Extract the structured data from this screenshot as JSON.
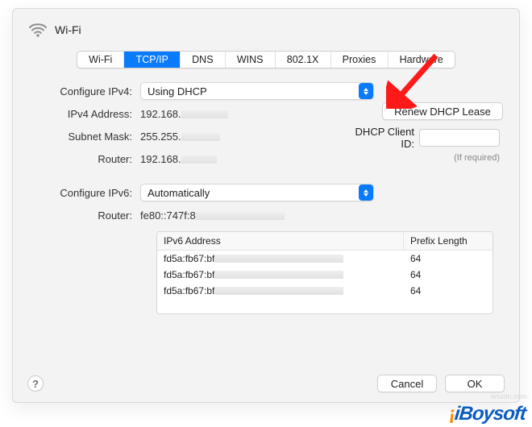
{
  "header": {
    "title": "Wi-Fi"
  },
  "tabs": [
    {
      "label": "Wi-Fi",
      "active": false
    },
    {
      "label": "TCP/IP",
      "active": true
    },
    {
      "label": "DNS",
      "active": false
    },
    {
      "label": "WINS",
      "active": false
    },
    {
      "label": "802.1X",
      "active": false
    },
    {
      "label": "Proxies",
      "active": false
    },
    {
      "label": "Hardware",
      "active": false
    }
  ],
  "ipv4": {
    "configure_label": "Configure IPv4:",
    "configure_value": "Using DHCP",
    "address_label": "IPv4 Address:",
    "address_value": "192.168.",
    "subnet_label": "Subnet Mask:",
    "subnet_value": "255.255.",
    "router_label": "Router:",
    "router_value": "192.168."
  },
  "dhcp": {
    "renew_label": "Renew DHCP Lease",
    "client_id_label": "DHCP Client ID:",
    "client_id_value": "",
    "hint": "(If required)"
  },
  "ipv6": {
    "configure_label": "Configure IPv6:",
    "configure_value": "Automatically",
    "router_label": "Router:",
    "router_value": "fe80::747f:8",
    "columns": {
      "address": "IPv6 Address",
      "prefix": "Prefix Length"
    },
    "rows": [
      {
        "address": "fd5a:fb67:bf",
        "prefix": "64"
      },
      {
        "address": "fd5a:fb67:bf",
        "prefix": "64"
      },
      {
        "address": "fd5a:fb67:bf",
        "prefix": "64"
      }
    ]
  },
  "footer": {
    "help": "?",
    "cancel": "Cancel",
    "ok": "OK"
  },
  "watermark": {
    "brand_prefix": "iBoy",
    "brand_suffix": "soft",
    "site": "wsxdn.com"
  }
}
